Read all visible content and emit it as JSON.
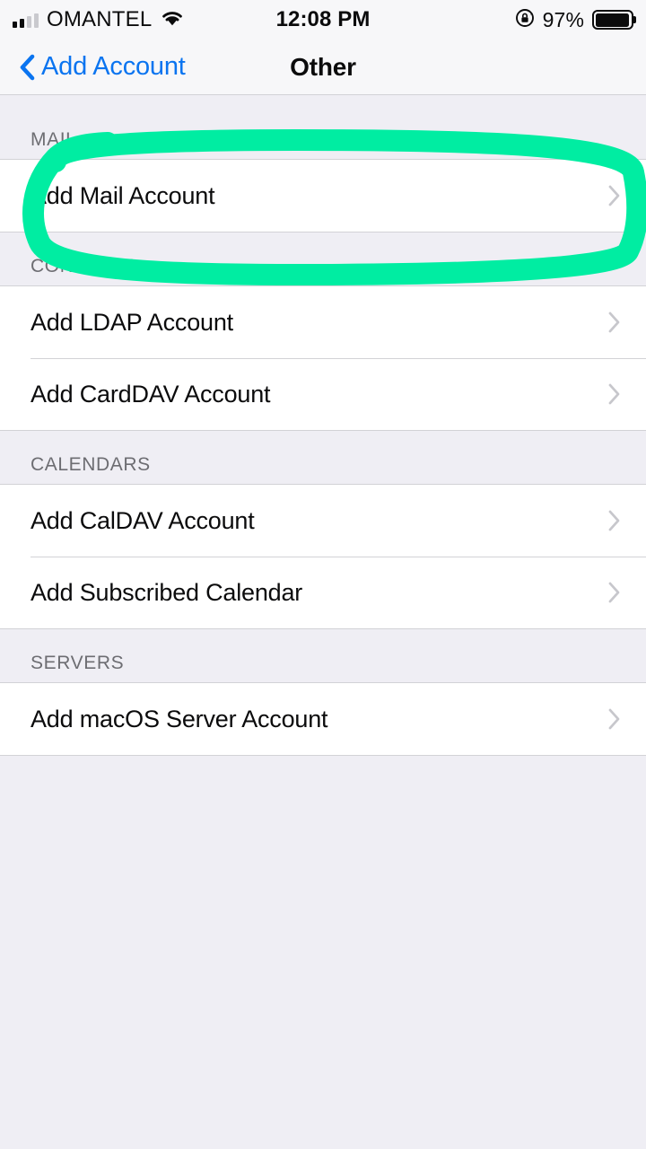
{
  "status_bar": {
    "carrier": "OMANTEL",
    "signal_bars_filled": 2,
    "signal_bars_total": 4,
    "wifi_icon": "wifi-icon",
    "time": "12:08 PM",
    "orientation_lock_icon": "rotation-lock-icon",
    "battery_percent": "97%",
    "battery_level": 97,
    "battery_icon": "battery-icon"
  },
  "nav_bar": {
    "back_label": "Add Account",
    "back_icon": "chevron-left-icon",
    "title": "Other"
  },
  "sections": [
    {
      "header": "MAIL",
      "rows": [
        {
          "label": "Add Mail Account",
          "accessory": "chevron-right-icon"
        }
      ]
    },
    {
      "header": "CONTACTS",
      "rows": [
        {
          "label": "Add LDAP Account",
          "accessory": "chevron-right-icon"
        },
        {
          "label": "Add CardDAV Account",
          "accessory": "chevron-right-icon"
        }
      ]
    },
    {
      "header": "CALENDARS",
      "rows": [
        {
          "label": "Add CalDAV Account",
          "accessory": "chevron-right-icon"
        },
        {
          "label": "Add Subscribed Calendar",
          "accessory": "chevron-right-icon"
        }
      ]
    },
    {
      "header": "SERVERS",
      "rows": [
        {
          "label": "Add macOS Server Account",
          "accessory": "chevron-right-icon"
        }
      ]
    }
  ],
  "annotation": {
    "shape": "hand-drawn-ellipse",
    "target": "Add Mail Account",
    "color": "#00EDA2",
    "stroke_width": 24
  },
  "colors": {
    "accent_blue": "#0A74F0",
    "group_background": "#FFFFFF",
    "table_background": "#EFEEF4",
    "bar_background": "#F7F7F9",
    "separator": "#D2D2D6",
    "header_text": "#6D6D72",
    "cell_text": "#0B0B0C",
    "chevron": "#C7C7CC",
    "highlight_green": "#00EDA2"
  }
}
